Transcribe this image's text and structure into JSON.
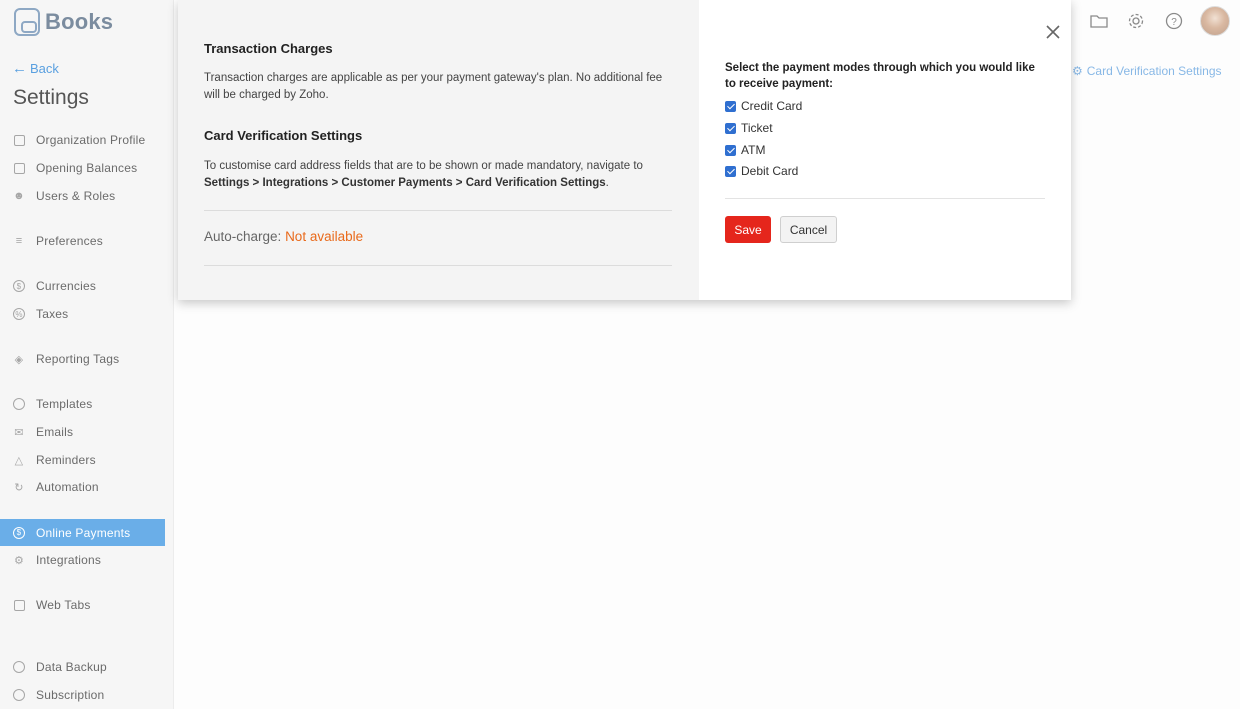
{
  "app": {
    "name": "Books"
  },
  "sidebar": {
    "back_label": "Back",
    "title": "Settings",
    "items": [
      {
        "label": "Organization Profile",
        "icon": "building-icon"
      },
      {
        "label": "Opening Balances",
        "icon": "ledger-icon"
      },
      {
        "label": "Users & Roles",
        "icon": "users-icon"
      },
      {
        "label": "Preferences",
        "icon": "sliders-icon"
      },
      {
        "label": "Currencies",
        "icon": "currency-icon"
      },
      {
        "label": "Taxes",
        "icon": "tax-icon"
      },
      {
        "label": "Reporting Tags",
        "icon": "tag-icon"
      },
      {
        "label": "Templates",
        "icon": "palette-icon"
      },
      {
        "label": "Emails",
        "icon": "mail-icon"
      },
      {
        "label": "Reminders",
        "icon": "bell-icon"
      },
      {
        "label": "Automation",
        "icon": "automation-icon"
      },
      {
        "label": "Online Payments",
        "icon": "payment-icon",
        "active": true
      },
      {
        "label": "Integrations",
        "icon": "integrations-icon"
      },
      {
        "label": "Web Tabs",
        "icon": "web-tabs-icon"
      },
      {
        "label": "Data Backup",
        "icon": "backup-icon"
      },
      {
        "label": "Subscription",
        "icon": "subscription-icon"
      }
    ]
  },
  "header": {
    "icons": [
      "folder-icon",
      "gear-icon",
      "help-icon",
      "avatar"
    ],
    "card_verification_link": "Card Verification Settings"
  },
  "modal": {
    "transaction_charges": {
      "heading": "Transaction Charges",
      "text": "Transaction charges are applicable as per your payment gateway's plan. No additional fee will be charged by Zoho."
    },
    "card_verification": {
      "heading": "Card Verification Settings",
      "text_prefix": "To customise card address fields that are to be shown or made mandatory, navigate to",
      "path": "Settings > Integrations > Customer Payments > Card Verification Settings",
      "text_suffix": "."
    },
    "auto_charge": {
      "label": "Auto-charge:",
      "value": "Not available"
    },
    "payment_modes": {
      "label": "Select the payment modes through which you would like to receive payment:",
      "options": [
        {
          "label": "Credit Card",
          "checked": true
        },
        {
          "label": "Ticket",
          "checked": true
        },
        {
          "label": "ATM",
          "checked": true
        },
        {
          "label": "Debit Card",
          "checked": true
        }
      ]
    },
    "save_label": "Save",
    "cancel_label": "Cancel"
  },
  "colors": {
    "accent": "#6aaee8",
    "save": "#e5261c",
    "not_available": "#e96a1b",
    "checkbox": "#2f6fd0"
  }
}
